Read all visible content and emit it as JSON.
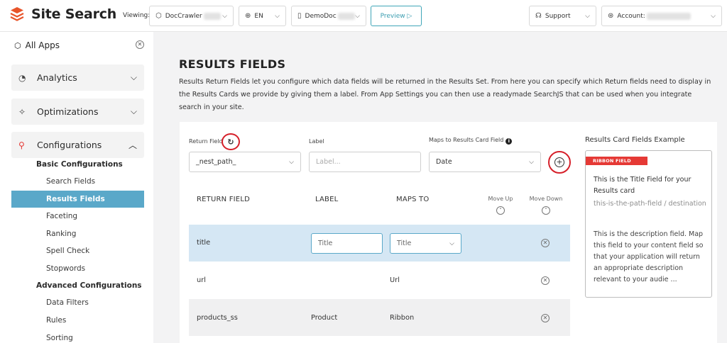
{
  "brand": {
    "title": "Site Search",
    "color": "#e8542a"
  },
  "topbar": {
    "viewing_label": "Viewing:",
    "app_select": "DocCrawler",
    "lang_select": "EN",
    "env_select": "DemoDoc",
    "preview_label": "Preview ▷",
    "support_label": "Support",
    "account_label": "Account:"
  },
  "sidebar": {
    "all_apps": "All Apps",
    "analytics": "Analytics",
    "optimizations": "Optimizations",
    "configurations": "Configurations",
    "basic_heading": "Basic Configurations",
    "basic_items": [
      "Search Fields",
      "Results Fields",
      "Faceting",
      "Ranking",
      "Spell Check",
      "Stopwords"
    ],
    "advanced_heading": "Advanced Configurations",
    "advanced_items": [
      "Data Filters",
      "Rules",
      "Sorting"
    ],
    "selected_item": "Results Fields",
    "accent": "#5aa8c9"
  },
  "main": {
    "title": "RESULTS FIELDS",
    "description": "Results Return Fields let you configure which data fields will be returned in the Results Set. From here you can specify which Return fields need to display in the Results Cards we provide by giving them a label. From App Settings you can then use a readymade SearchJS that can be used when you integrate search in your site."
  },
  "form": {
    "return_field_label": "Return Field",
    "label_label": "Label",
    "maps_label": "Maps to Results Card Field",
    "return_field_value": "_nest_path_",
    "label_placeholder": "Label...",
    "maps_value": "Date"
  },
  "table": {
    "headers": {
      "return_field": "RETURN FIELD",
      "label": "LABEL",
      "maps_to": "MAPS TO",
      "move_up": "Move Up",
      "move_down": "Move Down"
    },
    "rows": [
      {
        "field": "title",
        "label": "Title",
        "maps": "Title"
      },
      {
        "field": "url",
        "label": "",
        "maps": "Url"
      },
      {
        "field": "products_ss",
        "label": "Product",
        "maps": "Ribbon"
      }
    ]
  },
  "example": {
    "heading": "Results Card Fields Example",
    "ribbon": "RIBBON FIELD",
    "title_text": "This is the Title Field for your Results card",
    "path_text": "this-is-the-path-field / destination",
    "desc_text": "This is the description field. Map this field to your content field so that your application will return an appropriate description relevant to your audie ..."
  },
  "colors": {
    "annotation_red": "#d6202a",
    "ribbon_red": "#e53935",
    "selected_row": "#d5e7f4"
  }
}
